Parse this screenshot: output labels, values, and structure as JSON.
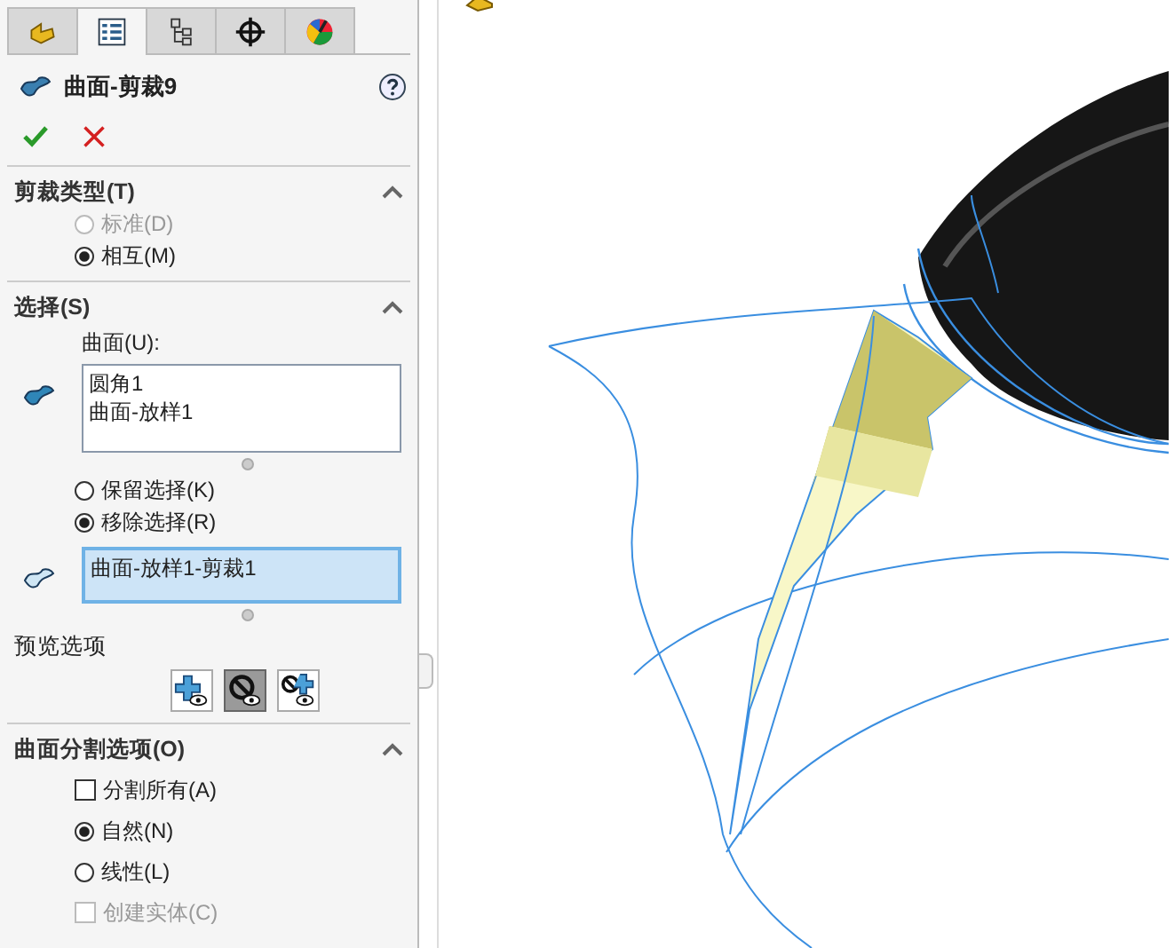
{
  "tabs": [
    {
      "kind": "feature",
      "selected": false
    },
    {
      "kind": "property",
      "selected": true
    },
    {
      "kind": "config",
      "selected": false
    },
    {
      "kind": "target",
      "selected": false
    },
    {
      "kind": "display",
      "selected": false
    }
  ],
  "feature": {
    "title": "曲面-剪裁9"
  },
  "trim_type": {
    "title": "剪裁类型(T)",
    "expanded": true,
    "options": [
      {
        "label": "标准(D)",
        "selected": false,
        "disabled": true
      },
      {
        "label": "相互(M)",
        "selected": true,
        "disabled": false
      }
    ]
  },
  "selection": {
    "title": "选择(S)",
    "expanded": true,
    "surfaces_label": "曲面(U):",
    "surfaces": [
      "圆角1",
      "曲面-放样1"
    ],
    "options": [
      {
        "label": "保留选择(K)",
        "selected": false,
        "disabled": false
      },
      {
        "label": "移除选择(R)",
        "selected": true,
        "disabled": false
      }
    ],
    "removed": {
      "items": [
        "曲面-放样1-剪裁1"
      ],
      "active": true
    }
  },
  "preview": {
    "label": "预览选项",
    "buttons": [
      {
        "kind": "add",
        "selected": false
      },
      {
        "kind": "remove",
        "selected": true
      },
      {
        "kind": "both",
        "selected": false
      }
    ]
  },
  "split": {
    "title": "曲面分割选项(O)",
    "expanded": true,
    "rows": [
      {
        "kind": "checkbox",
        "label": "分割所有(A)",
        "checked": false,
        "disabled": false
      },
      {
        "kind": "radio",
        "label": "自然(N)",
        "checked": true,
        "disabled": false
      },
      {
        "kind": "radio",
        "label": "线性(L)",
        "checked": false,
        "disabled": false
      },
      {
        "kind": "checkbox",
        "label": "创建实体(C)",
        "checked": false,
        "disabled": true
      }
    ]
  }
}
